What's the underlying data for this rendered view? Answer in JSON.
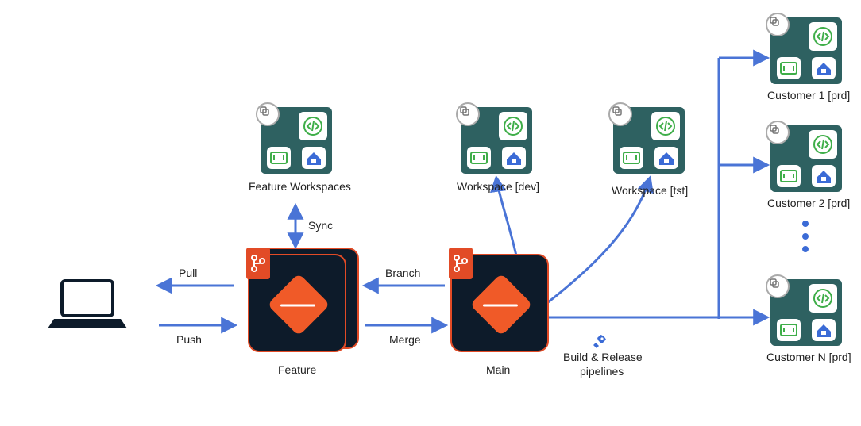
{
  "labels": {
    "pull": "Pull",
    "push": "Push",
    "sync": "Sync",
    "branch": "Branch",
    "merge": "Merge",
    "feature_repo": "Feature",
    "main_repo": "Main",
    "feature_ws": "Feature Workspaces",
    "ws_dev": "Workspace [dev]",
    "ws_tst": "Workspace [tst]",
    "cust1": "Customer 1 [prd]",
    "cust2": "Customer 2 [prd]",
    "custn": "Customer N [prd]",
    "pipelines_l1": "Build & Release",
    "pipelines_l2": "pipelines"
  },
  "icons": {
    "laptop": "laptop-icon",
    "git": "git-branch-icon",
    "code": "code-brackets-icon",
    "stack": "stack-icon",
    "stripe": "stripe-square-icon",
    "house": "house-icon",
    "rocket": "rocket-icon"
  },
  "workspaces": [
    {
      "key": "feature_ws",
      "label_key": "feature_ws"
    },
    {
      "key": "ws_dev",
      "label_key": "ws_dev"
    },
    {
      "key": "ws_tst",
      "label_key": "ws_tst"
    },
    {
      "key": "cust1",
      "label_key": "cust1"
    },
    {
      "key": "cust2",
      "label_key": "cust2"
    },
    {
      "key": "custn",
      "label_key": "custn"
    }
  ],
  "repos": [
    {
      "key": "feature",
      "label_key": "feature_repo",
      "stacked": true
    },
    {
      "key": "main",
      "label_key": "main_repo",
      "stacked": false
    }
  ],
  "colors": {
    "arrow": "#4a74d6",
    "ws_bg": "#2e6161",
    "repo_bg": "#0d1b2a",
    "repo_border": "#e24b26",
    "git_orange": "#f05a28",
    "code_green": "#3fae49",
    "blue": "#3b6bd6"
  }
}
